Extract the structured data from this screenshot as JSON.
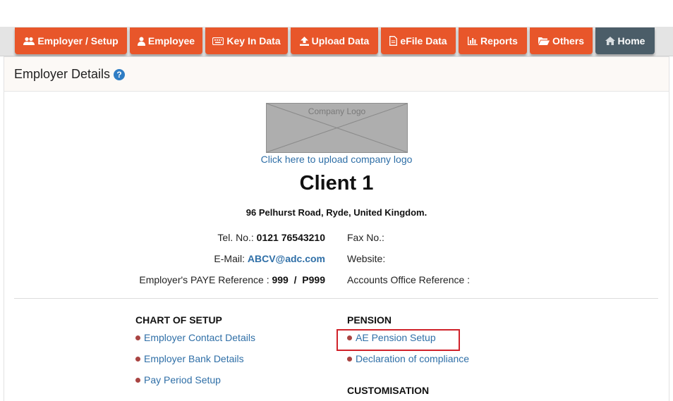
{
  "nav": {
    "items": [
      {
        "label": "Employer / Setup",
        "icon": "users-icon"
      },
      {
        "label": "Employee",
        "icon": "user-icon"
      },
      {
        "label": "Key In Data",
        "icon": "keyboard-icon"
      },
      {
        "label": "Upload Data",
        "icon": "upload-icon"
      },
      {
        "label": "eFile Data",
        "icon": "file-icon"
      },
      {
        "label": "Reports",
        "icon": "bar-chart-icon"
      },
      {
        "label": "Others",
        "icon": "folder-open-icon"
      },
      {
        "label": "Home",
        "icon": "home-icon"
      }
    ]
  },
  "panel": {
    "title": "Employer Details",
    "help_glyph": "?"
  },
  "company": {
    "logo_placeholder": "Company Logo",
    "upload_link": "Click here to upload company logo",
    "name": "Client 1",
    "address": "96 Pelhurst Road, Ryde, United Kingdom."
  },
  "contact": {
    "tel_label": "Tel. No.:",
    "tel_value": "0121 76543210",
    "email_label": "E-Mail:",
    "email_value": "ABCV@adc.com",
    "paye_label": "Employer's PAYE Reference :",
    "paye_value": "999  /  P999",
    "fax_label": "Fax No.:",
    "website_label": "Website:",
    "accounts_label": "Accounts Office Reference :"
  },
  "setup": {
    "title": "CHART OF SETUP",
    "links": [
      "Employer Contact Details",
      "Employer Bank Details",
      "Pay Period Setup"
    ]
  },
  "pension": {
    "title": "PENSION",
    "links": [
      "AE Pension Setup",
      "Declaration of compliance"
    ]
  },
  "customisation": {
    "title": "CUSTOMISATION"
  },
  "colors": {
    "nav_orange": "#e8562a",
    "nav_home": "#4b5d68",
    "link_blue": "#2f6fa7",
    "bullet_red": "#a94442",
    "highlight_red": "#d0222a"
  }
}
